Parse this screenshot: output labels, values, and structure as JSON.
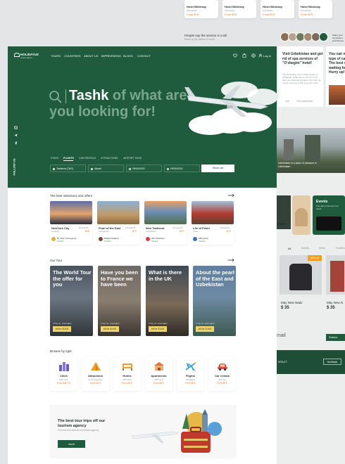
{
  "top_hotels": [
    {
      "name": "Hotel Bildirsay",
      "sub": "Uzbekistan",
      "price": "From $75"
    },
    {
      "name": "Hotel Bildirsay",
      "sub": "Uzbekistan",
      "price": "From $75"
    },
    {
      "name": "Hotel Bildirsay",
      "sub": "Uzbekistan",
      "price": "From $75"
    },
    {
      "name": "Hotel Bildirsay",
      "sub": "Uzbekistan",
      "price": "From $75"
    }
  ],
  "testimonial": {
    "line1": "People say the service is cool!",
    "line2": "Made up by visitors & hosts",
    "more": "Share your impression and find out about travelling"
  },
  "nav": {
    "logo": "HOLIDAYUZ",
    "logo_sub": "tourism agency",
    "items": [
      "TOURS",
      "COUNTRIES",
      "ABOUT US",
      "IMPRESSIONS",
      "BLOGS",
      "CONTACT"
    ],
    "login": "Log in"
  },
  "hero": {
    "word": "Tashk",
    "rest": " of what are",
    "line2": "you looking for!",
    "follow": "FOLLOW US",
    "tabs": [
      "STAYS",
      "FLIGHTS",
      "CAR RENTALS",
      "ATTRACTIONS",
      "AIRPORT TAXIS"
    ],
    "fields": [
      "Tashkent (TAS)",
      "Atlanti",
      "09/09/2020",
      "09/09/2020"
    ],
    "search": "Show List"
  },
  "offers": {
    "title": "The best selections and offers",
    "items": [
      {
        "name": "NewYork City",
        "tag": "Infographic",
        "loc": "America",
        "price": "$49",
        "agent": "By Victor 'land agency'",
        "verify": "Verified"
      },
      {
        "name": "Pearl of the East",
        "tag": "Infographic",
        "loc": "Uzbekistan",
        "price": "$79",
        "agent": "Madina Adilaeva",
        "verify": "Verified"
      },
      {
        "name": "New Tashkent",
        "tag": "Infographic",
        "loc": "Uzbekistan",
        "price": "$79",
        "agent": "Alif Uzbekistan",
        "verify": "Verified"
      },
      {
        "name": "Life of Pekin",
        "tag": "Infographic",
        "loc": "China",
        "price": "$79",
        "agent": "Silky Road",
        "verify": "Verified"
      }
    ]
  },
  "tours": {
    "title": "Our Tour",
    "items": [
      {
        "title": "The World Tour the offer for you",
        "meta": "4 city, 5+ overnights",
        "price": "All for $ 400"
      },
      {
        "title": "Have you been to France we have been",
        "meta": "4 city, 5+ overnights",
        "price": "All for $ 400"
      },
      {
        "title": "What is there in the UK",
        "meta": "4 city, 5+ overnights",
        "price": "All for $ 400"
      },
      {
        "title": "About the pearl of the East and Uzbekistan",
        "meta": "4 city, 5+ overnights",
        "price": "All for $ 400"
      }
    ]
  },
  "browse": {
    "title": "Browse by type",
    "items": [
      {
        "name": "Cities",
        "sub": "348 hotels",
        "price": "From $48 P.O",
        "icon": "city-icon",
        "color": "#6a5acd"
      },
      {
        "name": "Attractions",
        "sub": "at 76 attractions",
        "price": "From $5 U",
        "icon": "pyramid-icon",
        "color": "#f0a020"
      },
      {
        "name": "Hotels",
        "sub": "348 hotels",
        "price": "From $5 E",
        "icon": "hotel-icon",
        "color": "#e8a040"
      },
      {
        "name": "Apartments",
        "sub": "348 hotels",
        "price": "From $5 E",
        "icon": "apartment-icon",
        "color": "#e07040"
      },
      {
        "name": "Flights",
        "sub": "348 flights",
        "price": "From $5 E",
        "icon": "plane-icon",
        "color": "#3aa0e0"
      },
      {
        "name": "Car rentals",
        "sub": "348 cars",
        "price": "From $5 E",
        "icon": "car-icon",
        "color": "#e05050"
      }
    ]
  },
  "promo": {
    "title": "The best tour trips off our tourism agency",
    "sub": "The best tour trips off our tourism agency",
    "btn": "more"
  },
  "right": {
    "hotel_title": "Visit Uzbekistan and get rid of spa services of \"O'zbegim\" hotel!",
    "hotel_body": "The hospitality of the Uzbek people is worldwide. What are you there? If you have any financial thoughts, then with our country and see it with your own eyes!",
    "stat1": "120",
    "stat2": "120 comments",
    "far_title": "You can n type of ca The best c waiting fo Hurry up!",
    "ann": "Uzbekistan is a place of pleasure in Uzbekistan",
    "events": "Events",
    "events_sub": "The right of Events from travel",
    "cat_label": "Hotels",
    "tabs": [
      "All",
      "Jackets",
      "Shirts",
      "Hoodies"
    ],
    "badge": "30% off",
    "prod1": "May New Nadz",
    "prod1_price": "$ 35",
    "prod2": "May New N",
    "prod2_price": "$ 35",
    "mail": "mail",
    "subscribe": "Subscr",
    "contact": "NTACT",
    "feedback": "feedback"
  },
  "colors": {
    "brand": "#1f5b3d",
    "accent": "#e07b2e",
    "bg": "#e4e5e7"
  }
}
